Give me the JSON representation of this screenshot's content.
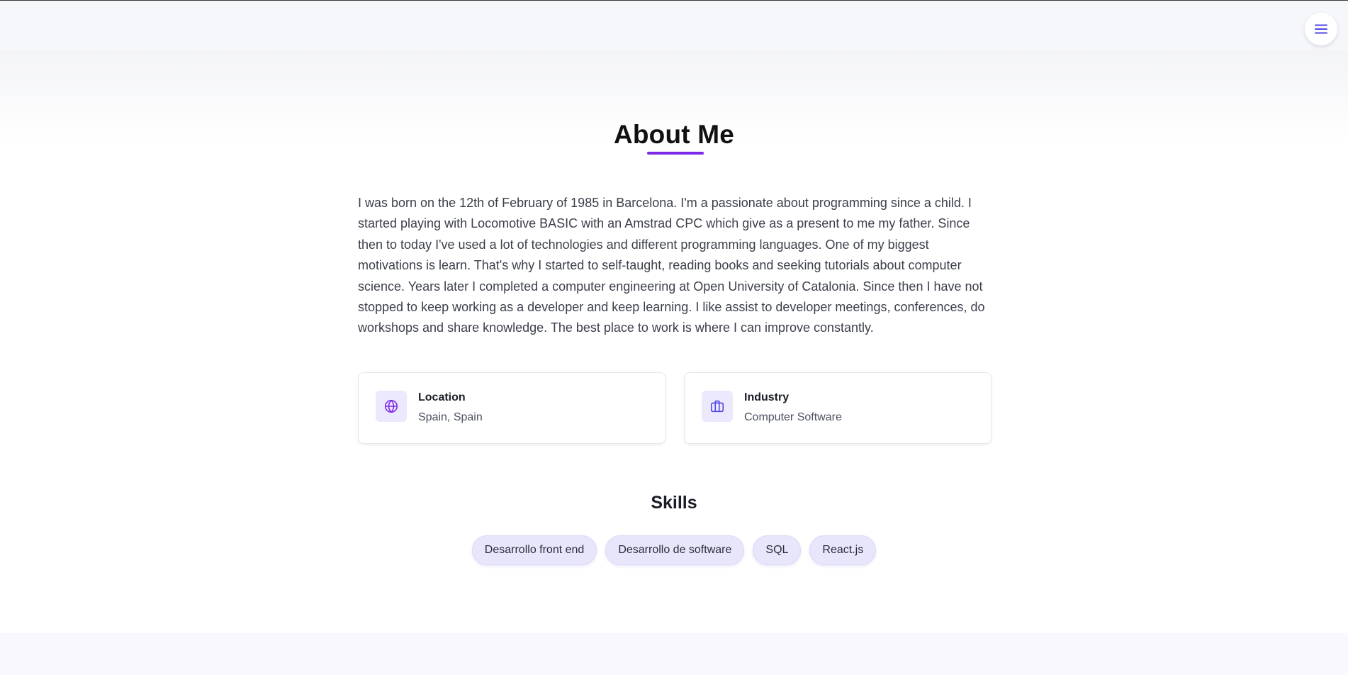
{
  "header": {
    "menu_icon": "hamburger-menu-icon"
  },
  "about": {
    "title": "About Me",
    "bio": "I was born on the 12th of February of 1985 in Barcelona. I'm a passionate about programming since a child. I started playing with Locomotive BASIC with an Amstrad CPC which give as a present to me my father. Since then to today I've used a lot of technologies and different programming languages. One of my biggest motivations is learn. That's why I started to self-taught, reading books and seeking tutorials about computer science. Years later I completed a computer engineering at Open University of Catalonia. Since then I have not stopped to keep working as a developer and keep learning. I like assist to developer meetings, conferences, do workshops and share knowledge. The best place to work is where I can improve constantly."
  },
  "info_cards": [
    {
      "icon": "globe-icon",
      "label": "Location",
      "value": "Spain, Spain"
    },
    {
      "icon": "briefcase-icon",
      "label": "Industry",
      "value": "Computer Software"
    }
  ],
  "skills": {
    "title": "Skills",
    "items": [
      "Desarrollo front end",
      "Desarrollo de software",
      "SQL",
      "React.js"
    ]
  },
  "colors": {
    "accent": "#7c2ae8",
    "icon_indigo": "#4f46e5",
    "chip_bg": "#e8e6fb",
    "icon_bg": "#ece8fd"
  }
}
